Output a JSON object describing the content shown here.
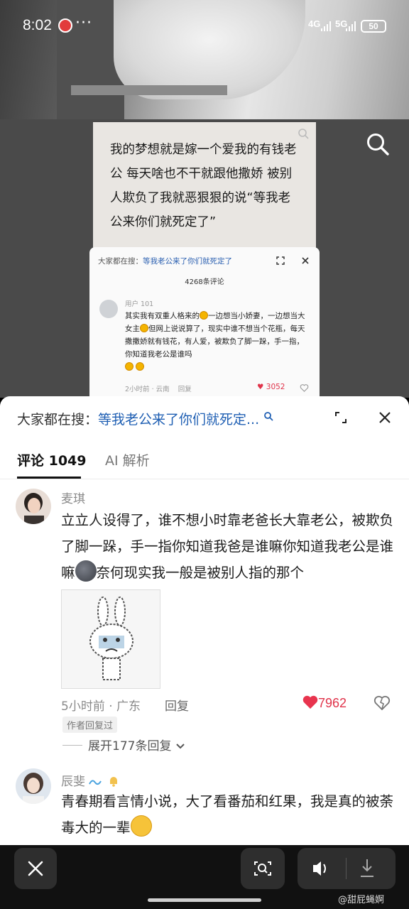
{
  "status_bar": {
    "time": "8:02",
    "dots": "···",
    "network1": "4G",
    "network2": "5G",
    "battery": "50"
  },
  "post": {
    "text": "我的梦想就是嫁一个爱我的有钱老公 每天啥也不干就跟他撒娇 被别人欺负了我就恶狠狠的说“等我老公来你们就死定了”"
  },
  "inner_screenshot": {
    "hot_label": "大家都在搜：",
    "hot_query": "等我老公来了你们就死定了",
    "comment_count": "4268条评论",
    "user": "用户 101",
    "text_parts": [
      "其实我有双重人格来的",
      "一边想当小娇妻，一边想当大女主",
      "但网上说说算了，现实中谁不想当个花瓶，每天撒撒娇就有钱花，有人爱，被欺负了脚一跺，手一指，你知道我老公是谁吗"
    ],
    "meta": "2小时前 · 云南",
    "reply": "回复",
    "likes": "3052"
  },
  "sheet": {
    "hot_label": "大家都在搜：",
    "hot_query": "等我老公来了你们就死定...",
    "tabs": [
      {
        "label": "评论 1049",
        "active": true
      },
      {
        "label": "AI 解析",
        "active": false
      }
    ]
  },
  "comments": [
    {
      "user": "麦琪",
      "text": "立立人设得了，谁不想小时靠老爸长大靠老公，被欺负了脚一跺，手一指你知道我爸是谁嘛你知道我老公是谁嘛",
      "text_after": "奈何现实我一般是被别人指的那个",
      "time": "5小时前 · 广东",
      "reply": "回复",
      "likes": "7962",
      "author_tag": "作者回复过",
      "expand": "展开177条回复"
    },
    {
      "user": "辰斐",
      "text": "青春期看言情小说，大了看番茄和红果，我是真的被荼毒大的一辈"
    }
  ],
  "watermark": "@甜屁蝇婀",
  "colors": {
    "accent_blue": "#1f5fb3",
    "like_red": "#e0334a",
    "sheet_bg": "#ffffff",
    "grey_zone": "#4a4a4a"
  }
}
